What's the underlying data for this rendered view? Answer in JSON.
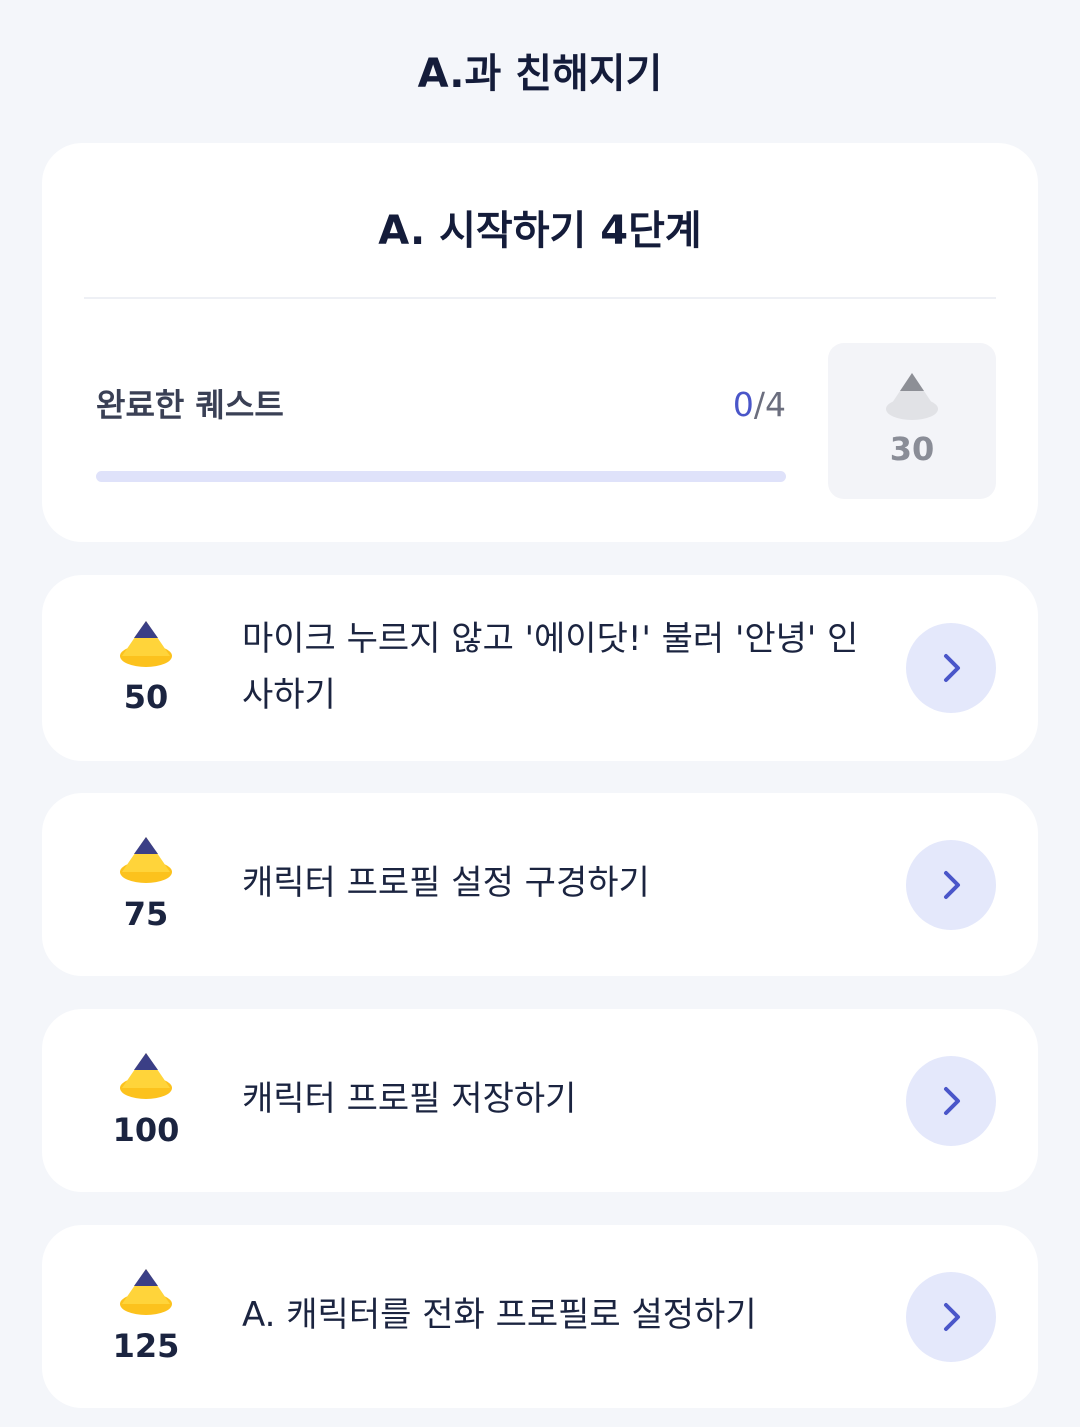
{
  "header": {
    "title": "A.과 친해지기"
  },
  "summary": {
    "title": "A. 시작하기 4단계",
    "progress_label": "완료한 퀘스트",
    "completed": "0",
    "separator": "/",
    "total": "4",
    "progress_fraction": 0,
    "reward": "30",
    "reward_icon": "cone-icon-gray"
  },
  "quests": [
    {
      "points": "50",
      "text": "마이크 누르지 않고 '에이닷!' 불러 '안녕' 인사하기",
      "icon": "cone-icon-yellow"
    },
    {
      "points": "75",
      "text": "캐릭터 프로필 설정 구경하기",
      "icon": "cone-icon-yellow"
    },
    {
      "points": "100",
      "text": "캐릭터 프로필 저장하기",
      "icon": "cone-icon-yellow"
    },
    {
      "points": "125",
      "text": "A. 캐릭터를 전화 프로필로 설정하기",
      "icon": "cone-icon-yellow"
    }
  ],
  "colors": {
    "accent": "#4a56c9",
    "cone_tip": "#3b3f86",
    "cone_body": "#ffd43a",
    "button_bg": "#e4e8fb"
  }
}
